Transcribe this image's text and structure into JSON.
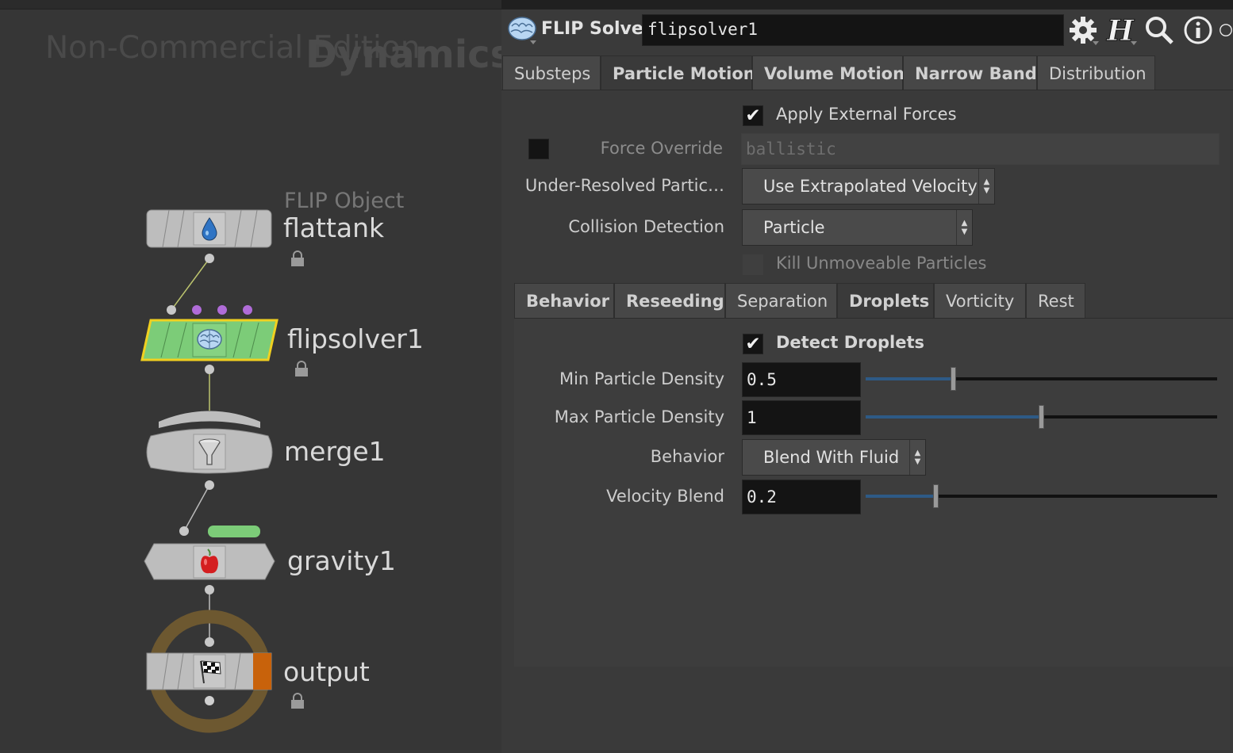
{
  "network": {
    "watermark": "Non-Commercial Edition",
    "context_label": "Dynamics",
    "nodes": [
      {
        "type_label": "FLIP Object",
        "name": "flattank",
        "icon": "water-drop-icon",
        "locked": true
      },
      {
        "name": "flipsolver1",
        "icon": "brain-icon",
        "locked": true,
        "selected": true,
        "color": "#7ccc78"
      },
      {
        "name": "merge1",
        "icon": "funnel-icon"
      },
      {
        "name": "gravity1",
        "icon": "apple-icon"
      },
      {
        "name": "output",
        "icon": "checkered-flag-icon",
        "locked": true,
        "output_flag_color": "#c8620b"
      }
    ]
  },
  "params": {
    "header": {
      "node_icon": "brain-icon",
      "type_label": "FLIP Solver",
      "node_name": "flipsolver1",
      "tools": [
        "gear-icon",
        "houdini-help-icon",
        "search-icon",
        "info-icon"
      ]
    },
    "tabs": [
      "Substeps",
      "Particle Motion",
      "Volume Motion",
      "Narrow Band",
      "Distribution"
    ],
    "active_tab": "Particle Motion",
    "apply_external_forces": {
      "label": "Apply External Forces",
      "checked": true
    },
    "force_override": {
      "label": "Force Override",
      "value": "ballistic",
      "enabled": false
    },
    "under_resolved": {
      "label": "Under-Resolved Partic…",
      "value": "Use Extrapolated Velocity"
    },
    "collision_detection": {
      "label": "Collision Detection",
      "value": "Particle"
    },
    "kill_unmoveable": {
      "label": "Kill Unmoveable Particles",
      "checked": false,
      "enabled": false
    },
    "subtabs": [
      "Behavior",
      "Reseeding",
      "Separation",
      "Droplets",
      "Vorticity",
      "Rest"
    ],
    "active_subtab": "Droplets",
    "droplets": {
      "detect": {
        "label": "Detect Droplets",
        "checked": true
      },
      "min_density": {
        "label": "Min Particle Density",
        "value": "0.5",
        "slider_fraction": 0.25
      },
      "max_density": {
        "label": "Max Particle Density",
        "value": "1",
        "slider_fraction": 0.5
      },
      "behavior": {
        "label": "Behavior",
        "value": "Blend With Fluid"
      },
      "velocity_blend": {
        "label": "Velocity Blend",
        "value": "0.2",
        "slider_fraction": 0.2
      }
    }
  },
  "colors": {
    "slider_fill": "#2e5a86",
    "selected_outline": "#f0d020",
    "input_dots": "#b06cd8",
    "gravity_flag": "#7ccc78"
  }
}
